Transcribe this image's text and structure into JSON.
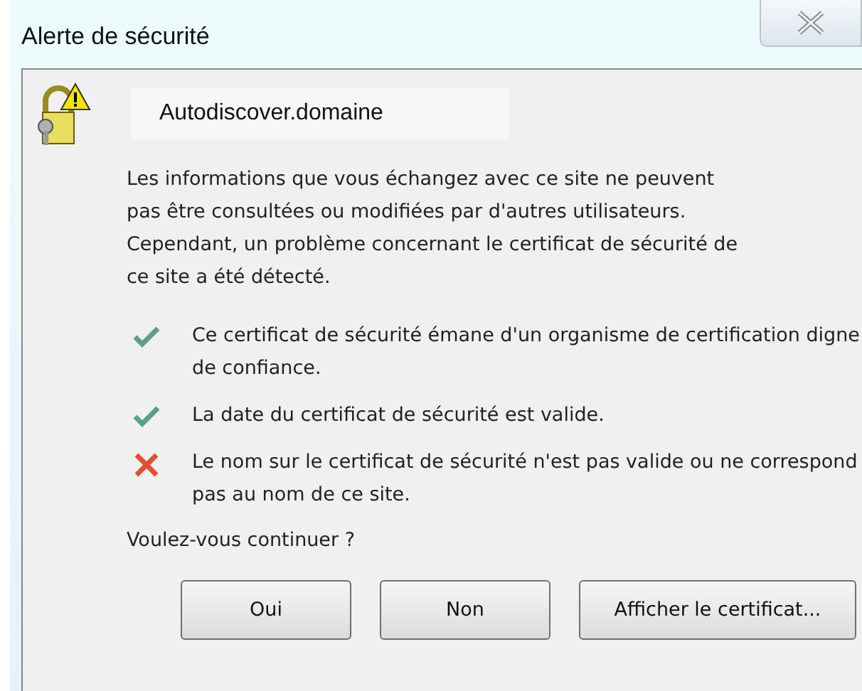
{
  "window": {
    "title": "Alerte de sécurité"
  },
  "host": "Autodiscover.domaine",
  "message": "Les informations que vous échangez avec ce site ne peuvent pas être consultées ou modifiées par d'autres utilisateurs. Cependant, un problème concernant le certificat de sécurité de ce site a été détecté.",
  "checks": [
    {
      "kind": "ok",
      "text": "Ce certificat de sécurité émane d'un organisme de certification digne de confiance."
    },
    {
      "kind": "ok",
      "text": "La date du certificat de sécurité est valide."
    },
    {
      "kind": "fail",
      "text": "Le nom sur le certificat de sécurité n'est pas valide ou ne correspond pas au nom de ce site."
    }
  ],
  "question": "Voulez-vous continuer ?",
  "buttons": [
    "Oui",
    "Non",
    "Afficher le certificat..."
  ]
}
